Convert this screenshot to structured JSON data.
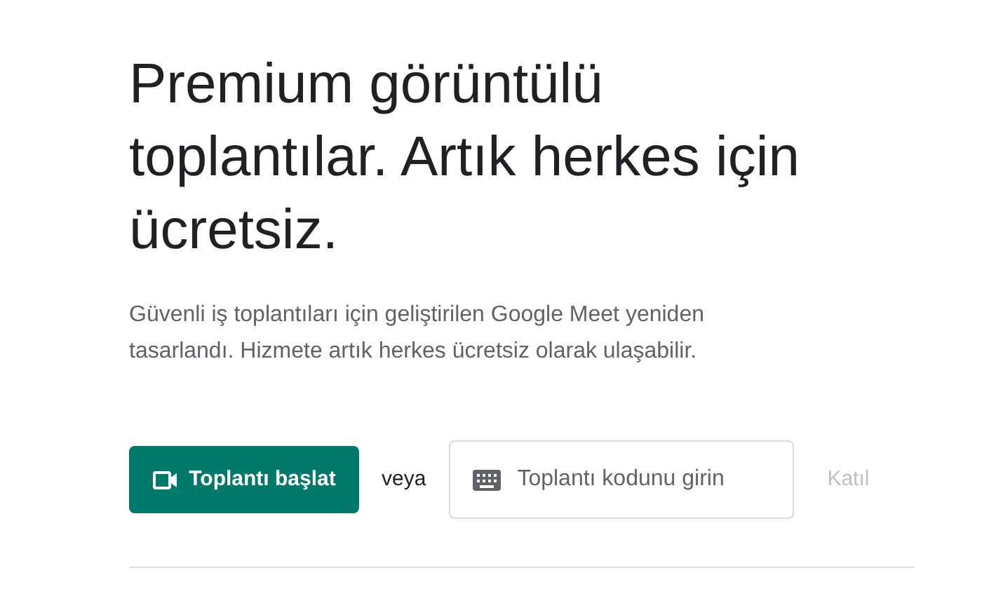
{
  "headline": "Premium görüntülü toplantılar. Artık herkes için ücretsiz.",
  "description": "Güvenli iş toplantıları için geliştirilen Google Meet yeniden tasarlandı. Hizmete artık herkes ücretsiz olarak ulaşabilir.",
  "start_button": {
    "label": "Toplantı başlat"
  },
  "separator": "veya",
  "code_field": {
    "placeholder": "Toplantı kodunu girin"
  },
  "join_button": {
    "label": "Katıl",
    "disabled": true
  }
}
